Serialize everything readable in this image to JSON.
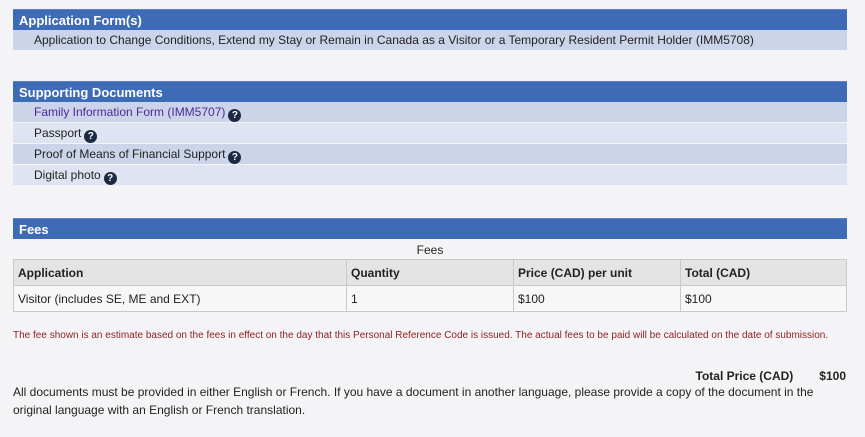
{
  "application_forms": {
    "title": "Application Form(s)",
    "items": [
      "Application to Change Conditions, Extend my Stay or Remain in Canada as a Visitor or a Temporary Resident Permit Holder (IMM5708)"
    ]
  },
  "supporting_documents": {
    "title": "Supporting Documents",
    "items": [
      {
        "label": "Family Information Form (IMM5707)",
        "help_icon": "question-circle-icon"
      },
      {
        "label": "Passport",
        "help_icon": "question-circle-icon"
      },
      {
        "label": "Proof of Means of Financial Support",
        "help_icon": "question-circle-icon"
      },
      {
        "label": "Digital photo",
        "help_icon": "question-circle-icon"
      }
    ]
  },
  "fees": {
    "title": "Fees",
    "table_caption": "Fees",
    "columns": [
      "Application",
      "Quantity",
      "Price (CAD) per unit",
      "Total (CAD)"
    ],
    "rows": [
      [
        "Visitor (includes SE, ME and EXT)",
        "1",
        "$100",
        "$100"
      ]
    ],
    "note": "The fee shown is an estimate based on the fees in effect on the day that this Personal Reference Code is issued. The actual fees to be paid will be calculated on the date of submission.",
    "total_label": "Total Price (CAD)",
    "total_value": "$100"
  },
  "footer_text": "All documents must be provided in either English or French. If you have a document in another language, please provide a copy of the document in the original language with an English or French translation.",
  "colors": {
    "header_blue": "#3e6bb6",
    "row_dark": "#ccd4ea",
    "row_light": "#dfe4f2",
    "link_purple": "#4b2a9a",
    "note_red": "#8c1f1f"
  }
}
